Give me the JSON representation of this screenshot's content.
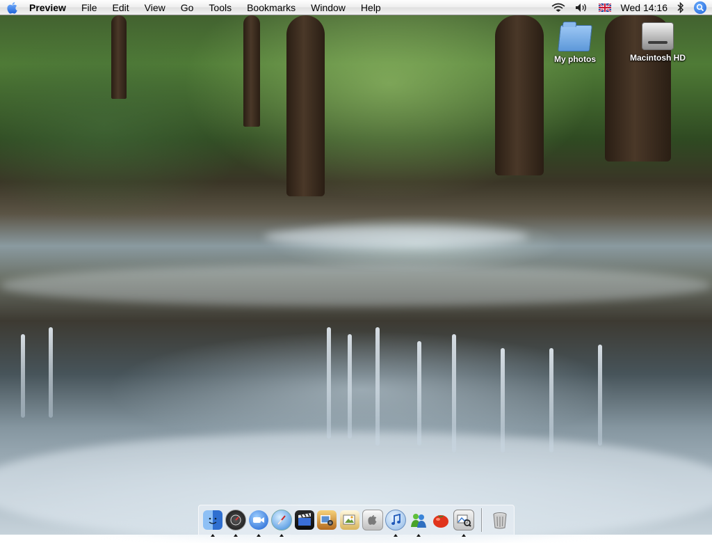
{
  "menubar": {
    "app_name": "Preview",
    "menus": [
      "File",
      "Edit",
      "View",
      "Go",
      "Tools",
      "Bookmarks",
      "Window",
      "Help"
    ],
    "clock": "Wed 14:16",
    "status_icons": [
      "wifi-icon",
      "volume-icon",
      "uk-flag-icon",
      "bluetooth-icon",
      "spotlight-icon"
    ]
  },
  "desktop_icons": [
    {
      "label": "My photos",
      "icon": "folder-icon"
    },
    {
      "label": "Macintosh HD",
      "icon": "hard-drive-icon"
    }
  ],
  "dock": {
    "apps": [
      {
        "icon": "finder-icon",
        "running": true
      },
      {
        "icon": "dashboard-icon",
        "running": true
      },
      {
        "icon": "ichat-video-icon",
        "running": true
      },
      {
        "icon": "safari-icon",
        "running": true
      },
      {
        "icon": "imovie-icon",
        "running": false
      },
      {
        "icon": "iphoto-icon",
        "running": false
      },
      {
        "icon": "preview-icon",
        "running": false
      },
      {
        "icon": "system-preferences-icon",
        "running": false
      },
      {
        "icon": "itunes-icon",
        "running": true
      },
      {
        "icon": "messenger-icon",
        "running": true
      },
      {
        "icon": "tomato-app-icon",
        "running": false
      },
      {
        "icon": "image-editor-icon",
        "running": true
      }
    ],
    "trash": {
      "icon": "trash-icon"
    }
  }
}
